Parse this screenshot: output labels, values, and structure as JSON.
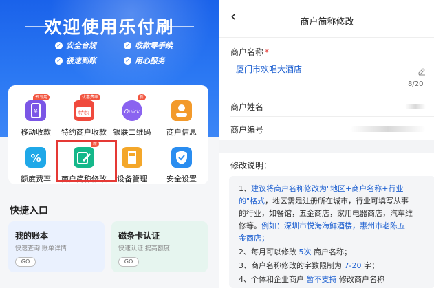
{
  "banner": {
    "title": "欢迎使用乐付刷",
    "features": [
      "安全合规",
      "收款零手续",
      "极速到账",
      "用心服务"
    ]
  },
  "menu": {
    "items": [
      {
        "label": "移动收款",
        "tag": "云专用",
        "icon": "phone-payment-icon",
        "color": "#7b56e6"
      },
      {
        "label": "特约商户收款",
        "tag": "优惠费率",
        "icon": "special-merchant-icon",
        "color": "#f04a3d"
      },
      {
        "label": "银联二维码",
        "tag": "新",
        "icon": "quickpass-qr-icon",
        "color": "#8a63f0"
      },
      {
        "label": "商户信息",
        "tag": "",
        "icon": "merchant-info-icon",
        "color": "#f39a2b"
      },
      {
        "label": "额度费率",
        "tag": "",
        "icon": "percent-rate-icon",
        "color": "#1fa8e8"
      },
      {
        "label": "商户简称修改",
        "tag": "新",
        "icon": "edit-name-icon",
        "color": "#14b88a"
      },
      {
        "label": "设备管理",
        "tag": "",
        "icon": "pos-device-icon",
        "color": "#f4a72a"
      },
      {
        "label": "安全设置",
        "tag": "",
        "icon": "security-shield-icon",
        "color": "#2a8df0"
      }
    ]
  },
  "quick": {
    "title": "快捷入口",
    "cards": [
      {
        "title": "我的账本",
        "sub": "快速查询 账单详情",
        "go": "GO",
        "bg": "#eaf1fe"
      },
      {
        "title": "磁条卡认证",
        "sub": "快速认证 提高额度",
        "go": "GO",
        "bg": "#e6f5ef"
      }
    ]
  },
  "edit": {
    "nav_title": "商户简称修改",
    "name_label": "商户名称",
    "required_mark": "*",
    "name_value": "厦门市欢唱大酒店",
    "counter": "8/20",
    "owner_label": "商户姓名",
    "no_label": "商户编号"
  },
  "notes": {
    "title": "修改说明：",
    "l1a": "1、",
    "l1b": "建议将商户名称修改为\"地区+商户名称+行业",
    "l2a": "的\"格式",
    "l2b": "，地区需是注册所在城市，行业可填写从事",
    "l3": "的行业，如餐馆，五金商店，家用电器商店，汽车维",
    "l4a": "修等。",
    "l4b": "例如：深圳市悦海海鲜酒楼，惠州市老陈五",
    "l5": "金商店；",
    "l6a": "2、每月可以修改",
    "l6b": "5次",
    "l6c": "商户名称；",
    "l7a": "3、商户名称修改的字数限制为",
    "l7b": "7-20",
    "l7c": "字；",
    "l8a": "4、个体和企业商户",
    "l8b": "暂不支持",
    "l8c": "修改商户名称"
  }
}
